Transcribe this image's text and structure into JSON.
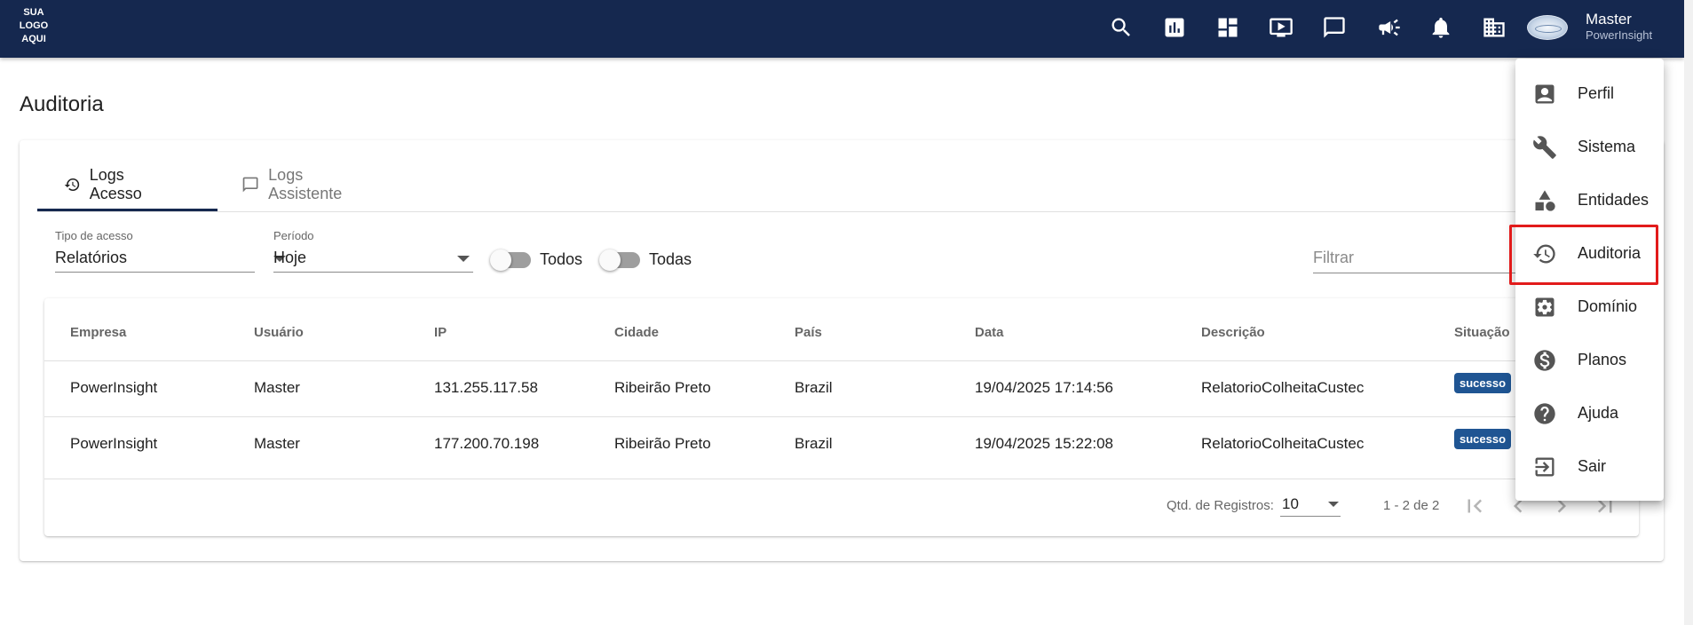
{
  "header": {
    "logo_text": "SUA\nLOGO\nAQUI",
    "icons": [
      "search-icon",
      "report-icon",
      "dashboard-icon",
      "video-icon",
      "chat-icon",
      "announcement-icon",
      "notifications-icon",
      "company-icon"
    ],
    "user_name": "Master",
    "user_org": "PowerInsight"
  },
  "page": {
    "title": "Auditoria"
  },
  "tabs": [
    {
      "label": "Logs Acesso",
      "icon": "history-icon",
      "active": true
    },
    {
      "label": "Logs Assistente",
      "icon": "chat-icon",
      "active": false
    }
  ],
  "filters": {
    "access_type": {
      "label": "Tipo de acesso",
      "value": "Relatórios"
    },
    "period": {
      "label": "Período",
      "value": "Hoje"
    },
    "toggle_all_users": {
      "label": "Todos",
      "on": false
    },
    "toggle_all_companies": {
      "label": "Todas",
      "on": false
    },
    "search": {
      "placeholder": "Filtrar",
      "value": ""
    }
  },
  "table": {
    "columns": [
      "Empresa",
      "Usuário",
      "IP",
      "Cidade",
      "País",
      "Data",
      "Descrição",
      "Situação"
    ],
    "rows": [
      {
        "empresa": "PowerInsight",
        "usuario": "Master",
        "ip": "131.255.117.58",
        "cidade": "Ribeirão Preto",
        "pais": "Brazil",
        "data": "19/04/2025 17:14:56",
        "descricao": "RelatorioColheitaCustec",
        "situacao": "sucesso"
      },
      {
        "empresa": "PowerInsight",
        "usuario": "Master",
        "ip": "177.200.70.198",
        "cidade": "Ribeirão Preto",
        "pais": "Brazil",
        "data": "19/04/2025 15:22:08",
        "descricao": "RelatorioColheitaCustec",
        "situacao": "sucesso"
      }
    ]
  },
  "pagination": {
    "label": "Qtd. de Registros:",
    "page_size": "10",
    "range": "1 - 2 de 2"
  },
  "user_menu": {
    "items": [
      {
        "label": "Perfil",
        "icon": "profile-icon"
      },
      {
        "label": "Sistema",
        "icon": "wrench-icon"
      },
      {
        "label": "Entidades",
        "icon": "shapes-icon"
      },
      {
        "label": "Auditoria",
        "icon": "history-icon",
        "highlighted": true
      },
      {
        "label": "Domínio",
        "icon": "settings-icon"
      },
      {
        "label": "Planos",
        "icon": "money-icon"
      },
      {
        "label": "Ajuda",
        "icon": "help-icon"
      },
      {
        "label": "Sair",
        "icon": "exit-icon"
      }
    ]
  },
  "colors": {
    "header_bg": "#15284f",
    "badge_bg": "#1f5593",
    "highlight": "#e21b1b"
  }
}
